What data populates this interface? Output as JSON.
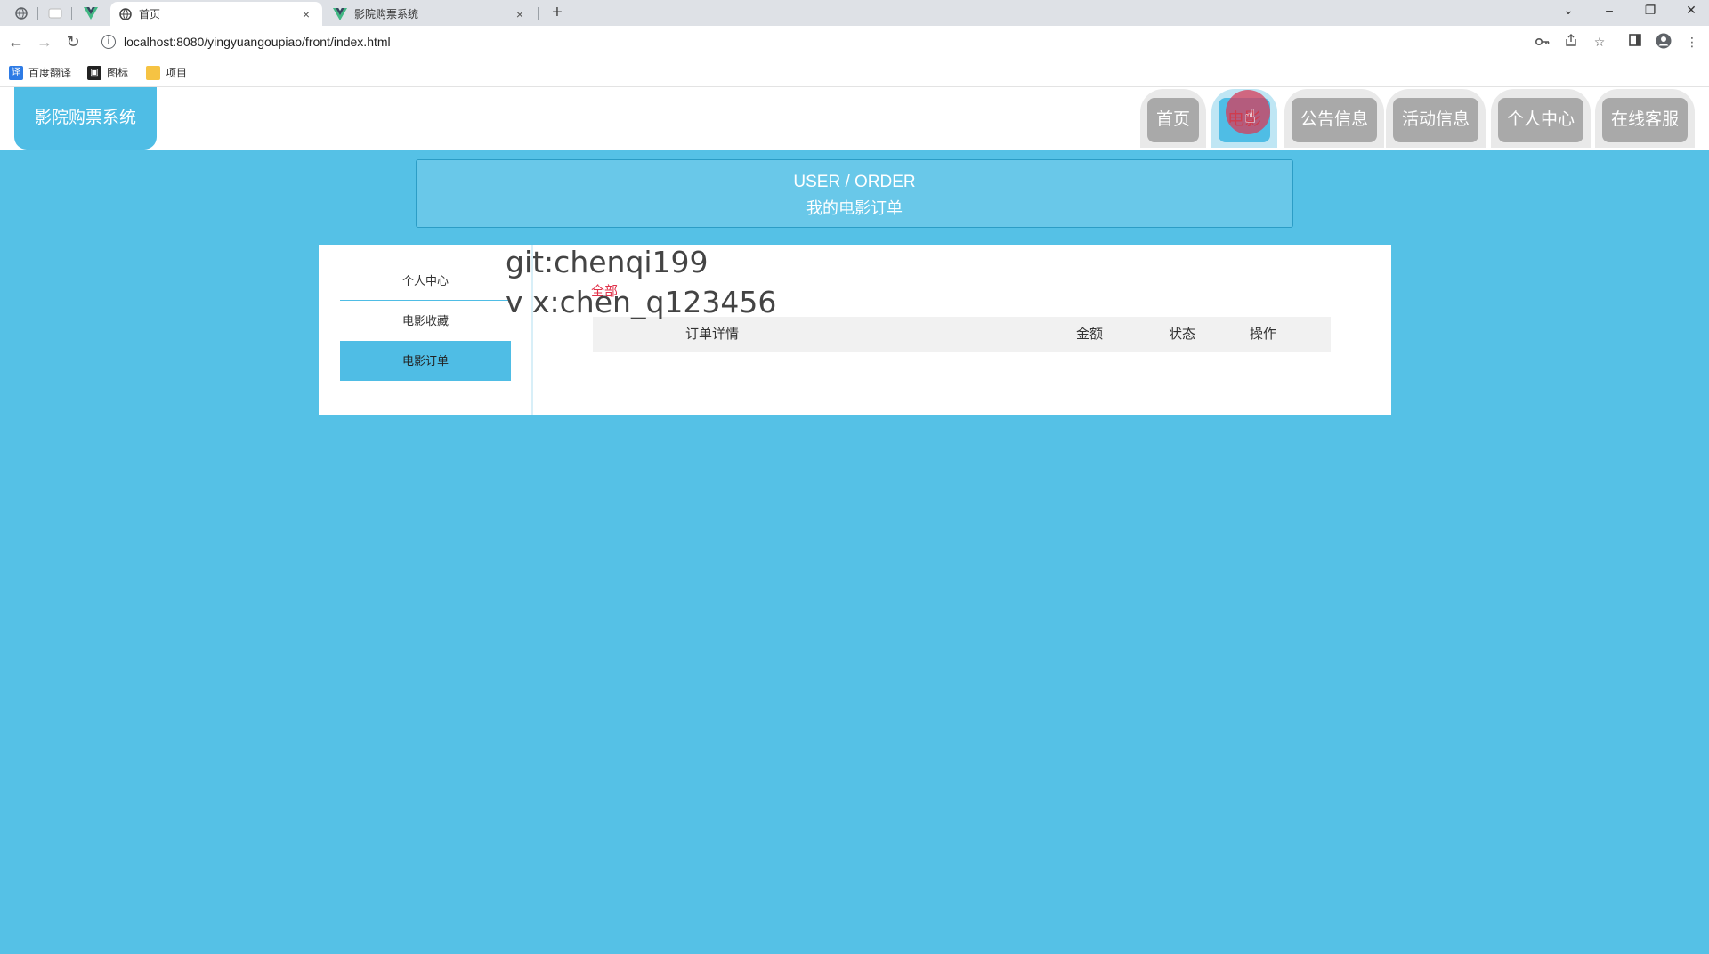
{
  "browser": {
    "tabs": [
      {
        "title": "首页",
        "close": "×"
      },
      {
        "title": "影院购票系统",
        "close": "×"
      }
    ],
    "new_tab": "+",
    "window_controls": [
      "⌄",
      "–",
      "❐",
      "✕"
    ],
    "url": "localhost:8080/yingyuangoupiao/front/index.html",
    "bookmarks": [
      {
        "label": "百度翻译",
        "icon": "translate-icon"
      },
      {
        "label": "图标",
        "icon": "image-icon"
      },
      {
        "label": "项目",
        "icon": "folder-icon"
      }
    ]
  },
  "header": {
    "logo": "影院购票系统",
    "nav": [
      "首页",
      "电影",
      "公告信息",
      "活动信息",
      "个人中心",
      "在线客服"
    ]
  },
  "breadcrumb": {
    "en": "USER / ORDER",
    "cn": "我的电影订单"
  },
  "sidebar": {
    "items": [
      "个人中心",
      "电影收藏",
      "电影订单"
    ]
  },
  "watermark": {
    "line1": "git:chenqi199",
    "line2": "v x:chen_q123456"
  },
  "orders": {
    "tab_all": "全部",
    "columns": [
      "订单详情",
      "金额",
      "状态",
      "操作"
    ]
  },
  "colors": {
    "accent": "#4fbde5",
    "background": "#55c1e6",
    "active_tab": "#e0324a"
  }
}
